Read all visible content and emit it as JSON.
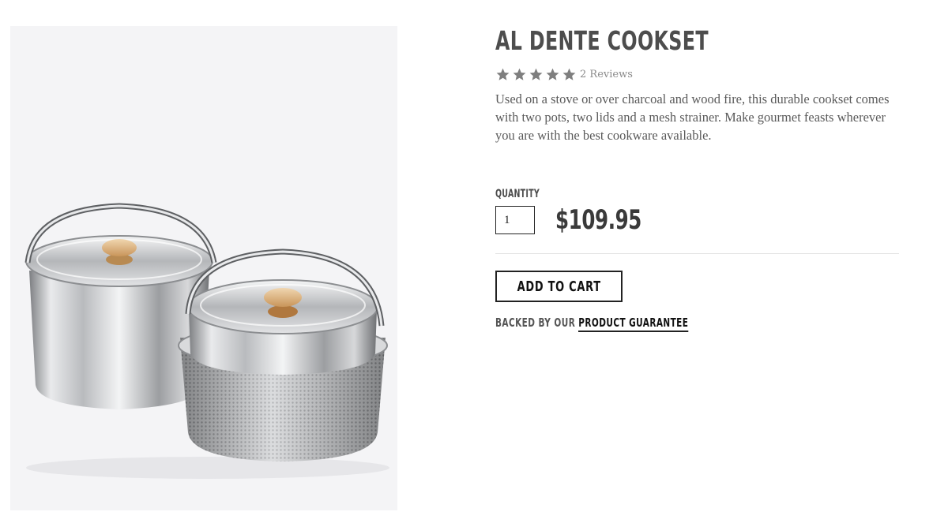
{
  "product": {
    "title": "AL DENTE COOKSET",
    "rating": 5,
    "reviews_label": "2 Reviews",
    "description": "Used on a stove or over charcoal and wood fire, this durable cookset comes with two pots, two lids and a mesh strainer. Make gourmet feasts wherever you are with the best cookware available.",
    "price": "$109.95"
  },
  "quantity": {
    "label": "QUANTITY",
    "value": "1"
  },
  "actions": {
    "add_to_cart_label": "ADD TO CART"
  },
  "guarantee": {
    "prefix": "BACKED BY OUR",
    "link_label": "PRODUCT GUARANTEE"
  },
  "icons": {
    "star": "star-icon"
  },
  "colors": {
    "star": "#7f7f7f",
    "image_background": "#f4f4f6",
    "text_dark": "#222222"
  }
}
